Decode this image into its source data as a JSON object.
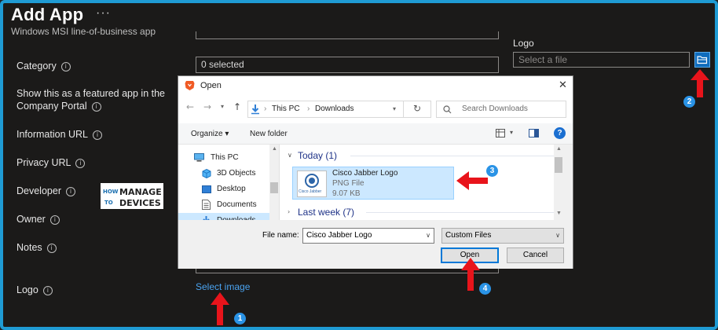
{
  "header": {
    "title": "Add App",
    "more_label": "···",
    "subtitle": "Windows MSI line-of-business app"
  },
  "form": {
    "fields": [
      {
        "label": "Category"
      },
      {
        "label": "Show this as a featured app in the"
      },
      {
        "label": "Company Portal"
      },
      {
        "label": "Information URL"
      },
      {
        "label": "Privacy URL"
      },
      {
        "label": "Developer"
      },
      {
        "label": "Owner"
      },
      {
        "label": "Notes"
      },
      {
        "label": "Logo"
      }
    ],
    "category_value": "0 selected",
    "info_glyph": "i",
    "select_image_link": "Select image"
  },
  "watermark": {
    "line1_left": "HOW",
    "line1_right": "MANAGE",
    "line2_left": "TO",
    "line2_right": "DEVICES"
  },
  "logo_panel": {
    "title": "Logo",
    "input_placeholder": "Select a file",
    "browse_icon": "folder-open-icon"
  },
  "dialog": {
    "title": "Open",
    "app_icon": "brave-browser-icon",
    "close_label": "✕",
    "breadcrumb": [
      "This PC",
      "Downloads"
    ],
    "search_placeholder": "Search Downloads",
    "toolbar": {
      "organize_label": "Organize ▾",
      "new_folder_label": "New folder",
      "help_label": "?"
    },
    "nav_items": [
      {
        "label": "This PC",
        "icon": "computer-icon"
      },
      {
        "label": "3D Objects",
        "icon": "cube-icon"
      },
      {
        "label": "Desktop",
        "icon": "desktop-icon"
      },
      {
        "label": "Documents",
        "icon": "document-icon"
      },
      {
        "label": "Downloads",
        "icon": "download-icon"
      }
    ],
    "groups": [
      {
        "label": "Today (1)"
      },
      {
        "label": "Last week (7)"
      }
    ],
    "file": {
      "name": "Cisco Jabber Logo",
      "type": "PNG File",
      "size": "9.07 KB",
      "thumb_text": "Cisco Jabber"
    },
    "file_name_label": "File name:",
    "file_name_value": "Cisco Jabber Logo",
    "filter_value": "Custom Files",
    "open_label": "Open",
    "cancel_label": "Cancel"
  },
  "annotations": {
    "badges": [
      "1",
      "2",
      "3",
      "4"
    ],
    "arrow_color": "#e8141b",
    "badge_color": "#2a93e6"
  },
  "colors": {
    "frame_border": "#1f9bd4",
    "background": "#1b1a19",
    "link": "#4aa3f0",
    "selection": "#cce8ff"
  }
}
